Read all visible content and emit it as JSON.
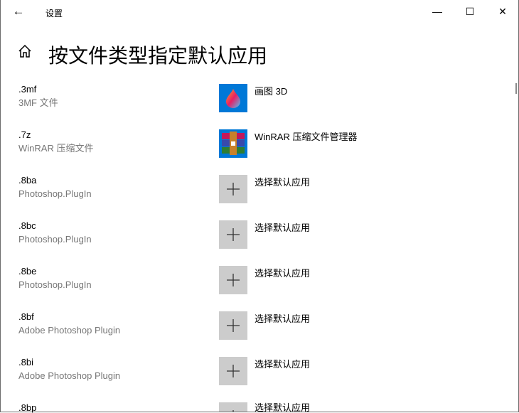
{
  "window": {
    "title": "设置",
    "minimize": "—",
    "maximize": "☐",
    "close": "✕",
    "back": "←"
  },
  "page": {
    "title": "按文件类型指定默认应用"
  },
  "rows": [
    {
      "ext": ".3mf",
      "desc": "3MF 文件",
      "app": "画图 3D",
      "icon": "paint3d-icon"
    },
    {
      "ext": ".7z",
      "desc": "WinRAR 压缩文件",
      "app": "WinRAR 压缩文件管理器",
      "icon": "winrar-icon"
    },
    {
      "ext": ".8ba",
      "desc": "Photoshop.PlugIn",
      "app": "选择默认应用",
      "icon": "plus-icon"
    },
    {
      "ext": ".8bc",
      "desc": "Photoshop.PlugIn",
      "app": "选择默认应用",
      "icon": "plus-icon"
    },
    {
      "ext": ".8be",
      "desc": "Photoshop.PlugIn",
      "app": "选择默认应用",
      "icon": "plus-icon"
    },
    {
      "ext": ".8bf",
      "desc": "Adobe Photoshop Plugin",
      "app": "选择默认应用",
      "icon": "plus-icon"
    },
    {
      "ext": ".8bi",
      "desc": "Adobe Photoshop Plugin",
      "app": "选择默认应用",
      "icon": "plus-icon"
    },
    {
      "ext": ".8bp",
      "desc": "",
      "app": "选择默认应用",
      "icon": "plus-icon"
    }
  ]
}
